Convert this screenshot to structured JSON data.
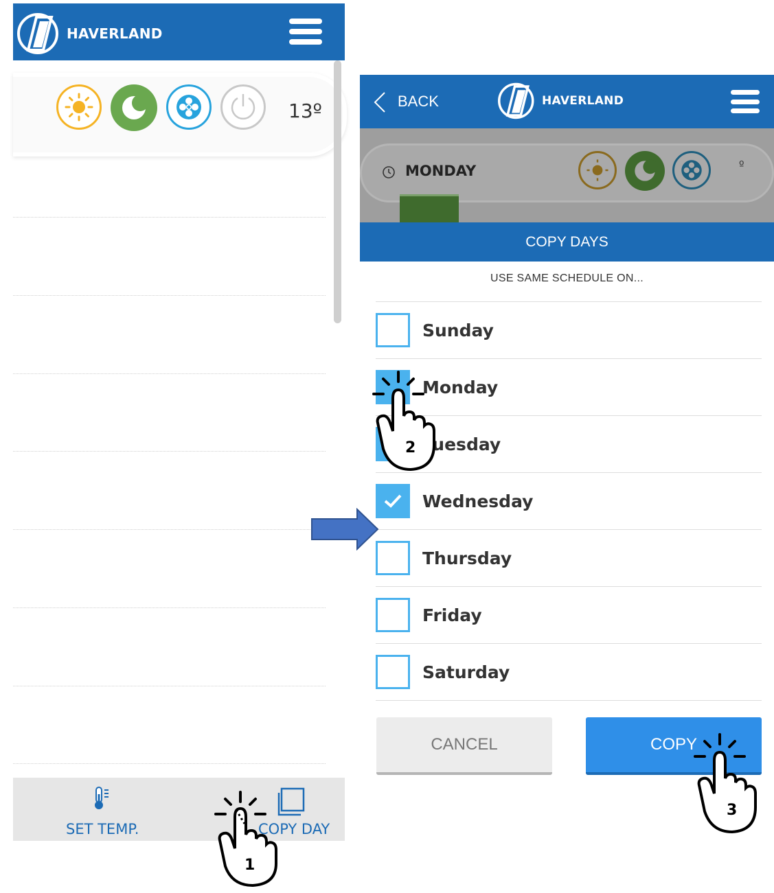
{
  "brand": {
    "name": "HAVERLAND"
  },
  "left_screen": {
    "modes": [
      "sun-icon",
      "moon-icon",
      "snowflake-icon",
      "power-icon"
    ],
    "temperature": "13º",
    "bottom_bar": {
      "set_temp_label": "SET TEMP.",
      "copy_day_label": "COPY DAY"
    }
  },
  "right_screen": {
    "back_label": "BACK",
    "day_title": "MONDAY",
    "dim_temp": "º",
    "dialog": {
      "title": "COPY DAYS",
      "subtitle": "USE SAME SCHEDULE ON...",
      "days": [
        {
          "label": "Sunday",
          "checked": false
        },
        {
          "label": "Monday",
          "checked": true
        },
        {
          "label": "Tuesday",
          "checked": true
        },
        {
          "label": "Wednesday",
          "checked": true
        },
        {
          "label": "Thursday",
          "checked": false
        },
        {
          "label": "Friday",
          "checked": false
        },
        {
          "label": "Saturday",
          "checked": false
        }
      ],
      "cancel_label": "CANCEL",
      "copy_label": "COPY"
    }
  },
  "annotations": {
    "step1": "1",
    "step2": "2",
    "step3": "3"
  },
  "colors": {
    "brand_blue": "#1c6bb5",
    "checkbox_blue": "#4ab2ee",
    "sun": "#f5b324",
    "moon": "#6aa84f",
    "snow": "#27a3dd",
    "power": "#c8c8c8",
    "arrow": "#4472c4"
  }
}
